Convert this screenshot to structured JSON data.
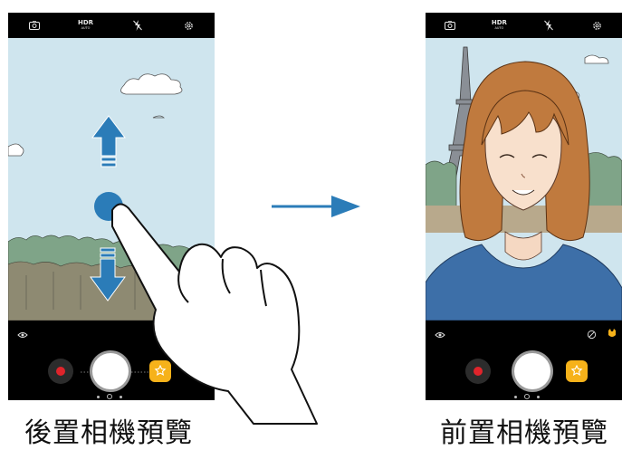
{
  "captions": {
    "rear": "後置相機預覽",
    "front": "前置相機預覽"
  },
  "camera_top_bar": {
    "hdr_label": "HDR",
    "hdr_sub": "AUTO",
    "icons": [
      "camera-switch-icon",
      "hdr-icon",
      "flash-off-icon",
      "gear-icon"
    ]
  },
  "gesture": {
    "swipe_directions": [
      "up",
      "down"
    ],
    "transition_arrow": "right"
  },
  "colors": {
    "arrow_blue": "#2b7cb8",
    "sky": "#cfe5ee",
    "record_red": "#e0242b",
    "sticker_yellow": "#f6b21a",
    "shirt_blue": "#3d6fa8",
    "hair_brown": "#c07a3e"
  }
}
